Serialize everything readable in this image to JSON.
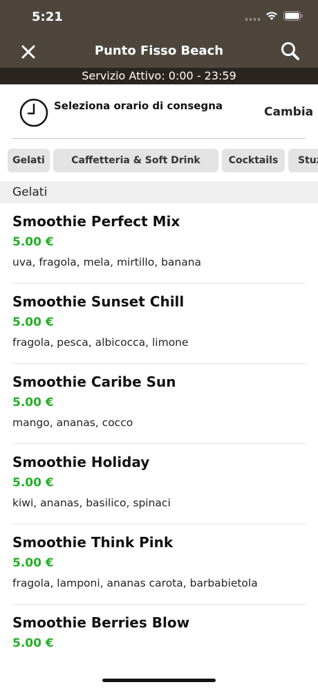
{
  "status_bar": {
    "time": "5:21"
  },
  "nav": {
    "title": "Punto Fisso Beach"
  },
  "service": {
    "text": "Servizio Attivo: 0:00 - 23:59"
  },
  "delivery": {
    "label": "Seleziona orario di consegna",
    "change": "Cambia"
  },
  "tabs": [
    {
      "label": "Gelati"
    },
    {
      "label": "Caffetteria & Soft Drink"
    },
    {
      "label": "Cocktails"
    },
    {
      "label": "Stuz"
    }
  ],
  "section": {
    "title": "Gelati"
  },
  "items": [
    {
      "name": "Smoothie Perfect Mix",
      "price": "5.00 €",
      "desc": "uva, fragola, mela, mirtillo, banana"
    },
    {
      "name": "Smoothie Sunset Chill",
      "price": "5.00 €",
      "desc": "fragola, pesca, albicocca, limone"
    },
    {
      "name": "Smoothie Caribe Sun",
      "price": "5.00 €",
      "desc": "mango, ananas, cocco"
    },
    {
      "name": "Smoothie Holiday",
      "price": "5.00 €",
      "desc": "kiwi, ananas, basilico, spinaci"
    },
    {
      "name": "Smoothie Think Pink",
      "price": "5.00 €",
      "desc": "fragola, lamponi, ananas carota, barbabietola"
    },
    {
      "name": "Smoothie Berries Blow",
      "price": "5.00 €",
      "desc": ""
    }
  ],
  "colors": {
    "header_bg": "#4e463d",
    "service_bg": "#2b2520",
    "price": "#22b026",
    "tab_bg": "#e3e3e3"
  }
}
